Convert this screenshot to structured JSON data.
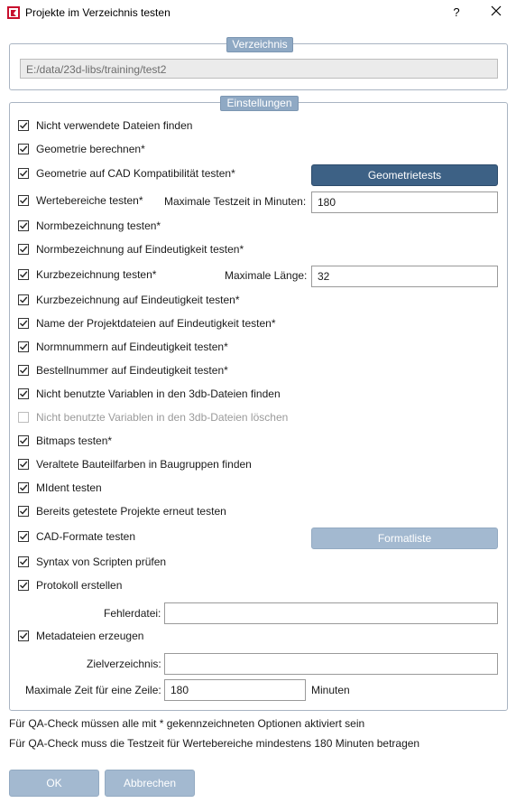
{
  "window": {
    "title": "Projekte im Verzeichnis testen",
    "help_label": "?",
    "close_icon": "close-icon",
    "app_icon": "app-logo-icon"
  },
  "directory_group": {
    "legend": "Verzeichnis",
    "path": "E:/data/23d-libs/training/test2"
  },
  "settings_group": {
    "legend": "Einstellungen",
    "options": [
      {
        "label": "Nicht verwendete Dateien finden",
        "checked": true,
        "enabled": true
      },
      {
        "label": "Geometrie berechnen*",
        "checked": true,
        "enabled": true
      },
      {
        "label": "Geometrie auf CAD Kompatibilität testen*",
        "checked": true,
        "enabled": true
      },
      {
        "label": "Wertebereiche testen*",
        "checked": true,
        "enabled": true
      },
      {
        "label": "Normbezeichnung testen*",
        "checked": true,
        "enabled": true
      },
      {
        "label": "Normbezeichnung auf Eindeutigkeit testen*",
        "checked": true,
        "enabled": true
      },
      {
        "label": "Kurzbezeichnung testen*",
        "checked": true,
        "enabled": true
      },
      {
        "label": "Kurzbezeichnung auf Eindeutigkeit testen*",
        "checked": true,
        "enabled": true
      },
      {
        "label": "Name der Projektdateien auf Eindeutigkeit testen*",
        "checked": true,
        "enabled": true
      },
      {
        "label": "Normnummern auf Eindeutigkeit testen*",
        "checked": true,
        "enabled": true
      },
      {
        "label": "Bestellnummer auf Eindeutigkeit testen*",
        "checked": true,
        "enabled": true
      },
      {
        "label": "Nicht benutzte Variablen in den 3db-Dateien finden",
        "checked": true,
        "enabled": true
      },
      {
        "label": "Nicht benutzte Variablen in den 3db-Dateien löschen",
        "checked": false,
        "enabled": false
      },
      {
        "label": "Bitmaps testen*",
        "checked": true,
        "enabled": true
      },
      {
        "label": "Veraltete Bauteilfarben in Baugruppen finden",
        "checked": true,
        "enabled": true
      },
      {
        "label": "MIdent testen",
        "checked": true,
        "enabled": true
      },
      {
        "label": "Bereits getestete Projekte erneut testen",
        "checked": true,
        "enabled": true
      },
      {
        "label": "CAD-Formate testen",
        "checked": true,
        "enabled": true
      },
      {
        "label": "Syntax von Scripten prüfen",
        "checked": true,
        "enabled": true
      },
      {
        "label": "Protokoll erstellen",
        "checked": true,
        "enabled": true
      },
      {
        "label": "Metadateien erzeugen",
        "checked": true,
        "enabled": true
      }
    ],
    "geometry_tests_button": "Geometrietests",
    "max_test_time_label": "Maximale Testzeit in Minuten:",
    "max_test_time_value": "180",
    "max_length_label": "Maximale Länge:",
    "max_length_value": "32",
    "format_list_button": "Formatliste",
    "error_file_label": "Fehlerdatei:",
    "error_file_value": "",
    "target_dir_label": "Zielverzeichnis:",
    "target_dir_value": "",
    "max_row_time_label": "Maximale Zeit für eine Zeile:",
    "max_row_time_value": "180",
    "max_row_time_unit": "Minuten"
  },
  "notes": [
    "Für QA-Check müssen alle mit * gekennzeichneten Optionen aktiviert sein",
    "Für QA-Check muss die Testzeit für Wertebereiche mindestens 180 Minuten betragen"
  ],
  "footer": {
    "ok_label": "OK",
    "cancel_label": "Abbrechen"
  }
}
